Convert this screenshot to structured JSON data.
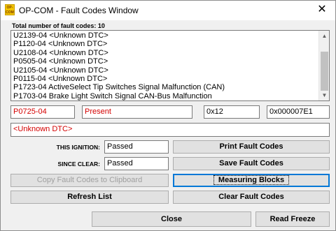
{
  "window": {
    "icon_text": "OP-COM",
    "title": "OP-COM - Fault Codes Window",
    "close_glyph": "✕"
  },
  "summary": {
    "total_label": "Total number of fault codes:  10"
  },
  "fault_list": {
    "items": [
      "U2139-04 <Unknown DTC>",
      "P1120-04 <Unknown DTC>",
      "U2108-04 <Unknown DTC>",
      "P0505-04 <Unknown DTC>",
      "U2105-04 <Unknown DTC>",
      "P0115-04 <Unknown DTC>",
      "P1723-04 ActiveSelect Tip Switches Signal Malfunction (CAN)",
      "P1703-04 Brake Light Switch Signal CAN-Bus Malfunction"
    ],
    "scroll_up_glyph": "▲",
    "scroll_down_glyph": "▼"
  },
  "detail": {
    "code": "P0725-04",
    "status": "Present",
    "byte": "0x12",
    "address": "0x000007E1",
    "description": "<Unknown DTC>",
    "code_color": "#d40000"
  },
  "ignition": {
    "this_ignition_label": "THIS IGNITION:",
    "this_ignition_value": "Passed",
    "since_clear_label": "SINCE CLEAR:",
    "since_clear_value": "Passed"
  },
  "buttons": {
    "print": "Print Fault Codes",
    "save": "Save Fault Codes",
    "copy": "Copy Fault Codes to Clipboard",
    "measuring": "Measuring Blocks",
    "refresh": "Refresh List",
    "clear": "Clear Fault Codes",
    "close": "Close",
    "read_freeze": "Read Freeze"
  }
}
